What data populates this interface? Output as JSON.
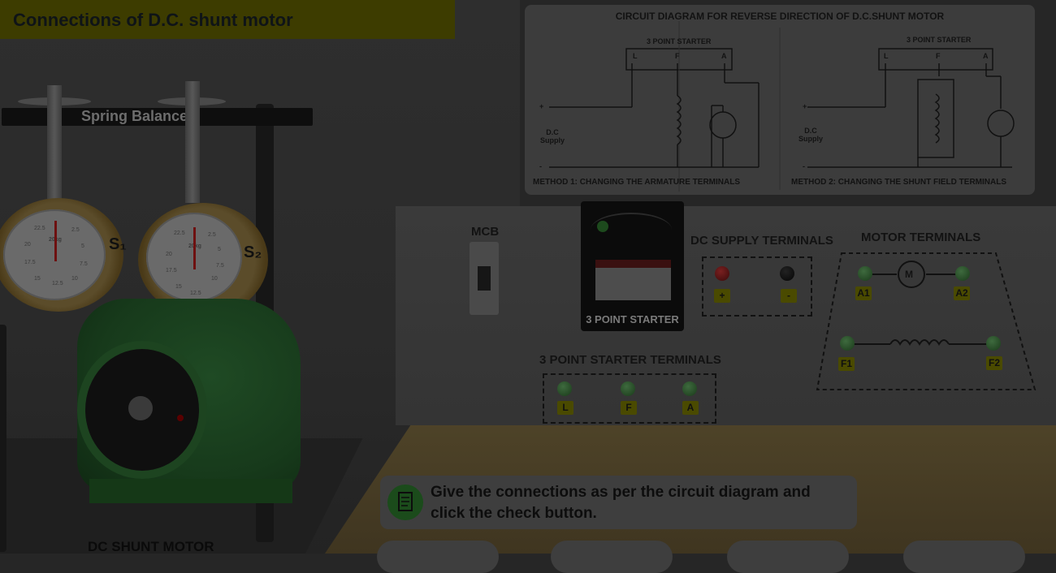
{
  "title": "Connections of D.C. shunt motor",
  "rig": {
    "spring_balance_label": "Spring Balance",
    "dial1": {
      "tag": "S₁",
      "numbers": [
        "22.5",
        "2.5",
        "5",
        "7.5",
        "10",
        "12.5",
        "15",
        "17.5",
        "20"
      ]
    },
    "dial2": {
      "tag": "S₂",
      "numbers": [
        "22.5",
        "2.5",
        "5",
        "7.5",
        "10",
        "12.5",
        "15",
        "17.5",
        "20"
      ]
    },
    "dial_unit": "20kg",
    "motor_label": "DC SHUNT MOTOR"
  },
  "diagram": {
    "title": "CIRCUIT DIAGRAM FOR REVERSE DIRECTION OF D.C.SHUNT MOTOR",
    "method1": {
      "starter_label": "3 POINT STARTER",
      "terminals": [
        "L",
        "F",
        "A"
      ],
      "supply_label": "D.C\nSupply",
      "plus": "+",
      "minus": "-",
      "caption": "METHOD 1: CHANGING THE ARMATURE TERMINALS"
    },
    "method2": {
      "starter_label": "3 POINT STARTER",
      "terminals": [
        "L",
        "F",
        "A"
      ],
      "supply_label": "D.C\nSupply",
      "plus": "+",
      "minus": "-",
      "caption": "METHOD 2: CHANGING THE SHUNT FIELD TERMINALS"
    }
  },
  "board": {
    "mcb_label": "MCB",
    "starter_label": "3 POINT STARTER",
    "dc_supply_label": "DC SUPPLY TERMINALS",
    "dc_plus": "+",
    "dc_minus": "-",
    "motor_terminals_label": "MOTOR TERMINALS",
    "motor_symbol": "M",
    "motor_terms": [
      "A1",
      "A2",
      "F1",
      "F2"
    ],
    "starter_terminals_label": "3 POINT STARTER TERMINALS",
    "starter_terms": [
      "L",
      "F",
      "A"
    ]
  },
  "instruction": "Give the connections as per the circuit diagram and click the check button.",
  "colors": {
    "title_bar": "#3d3c00",
    "overlay_dim": "#262626",
    "motor_green": "#1d4420"
  }
}
